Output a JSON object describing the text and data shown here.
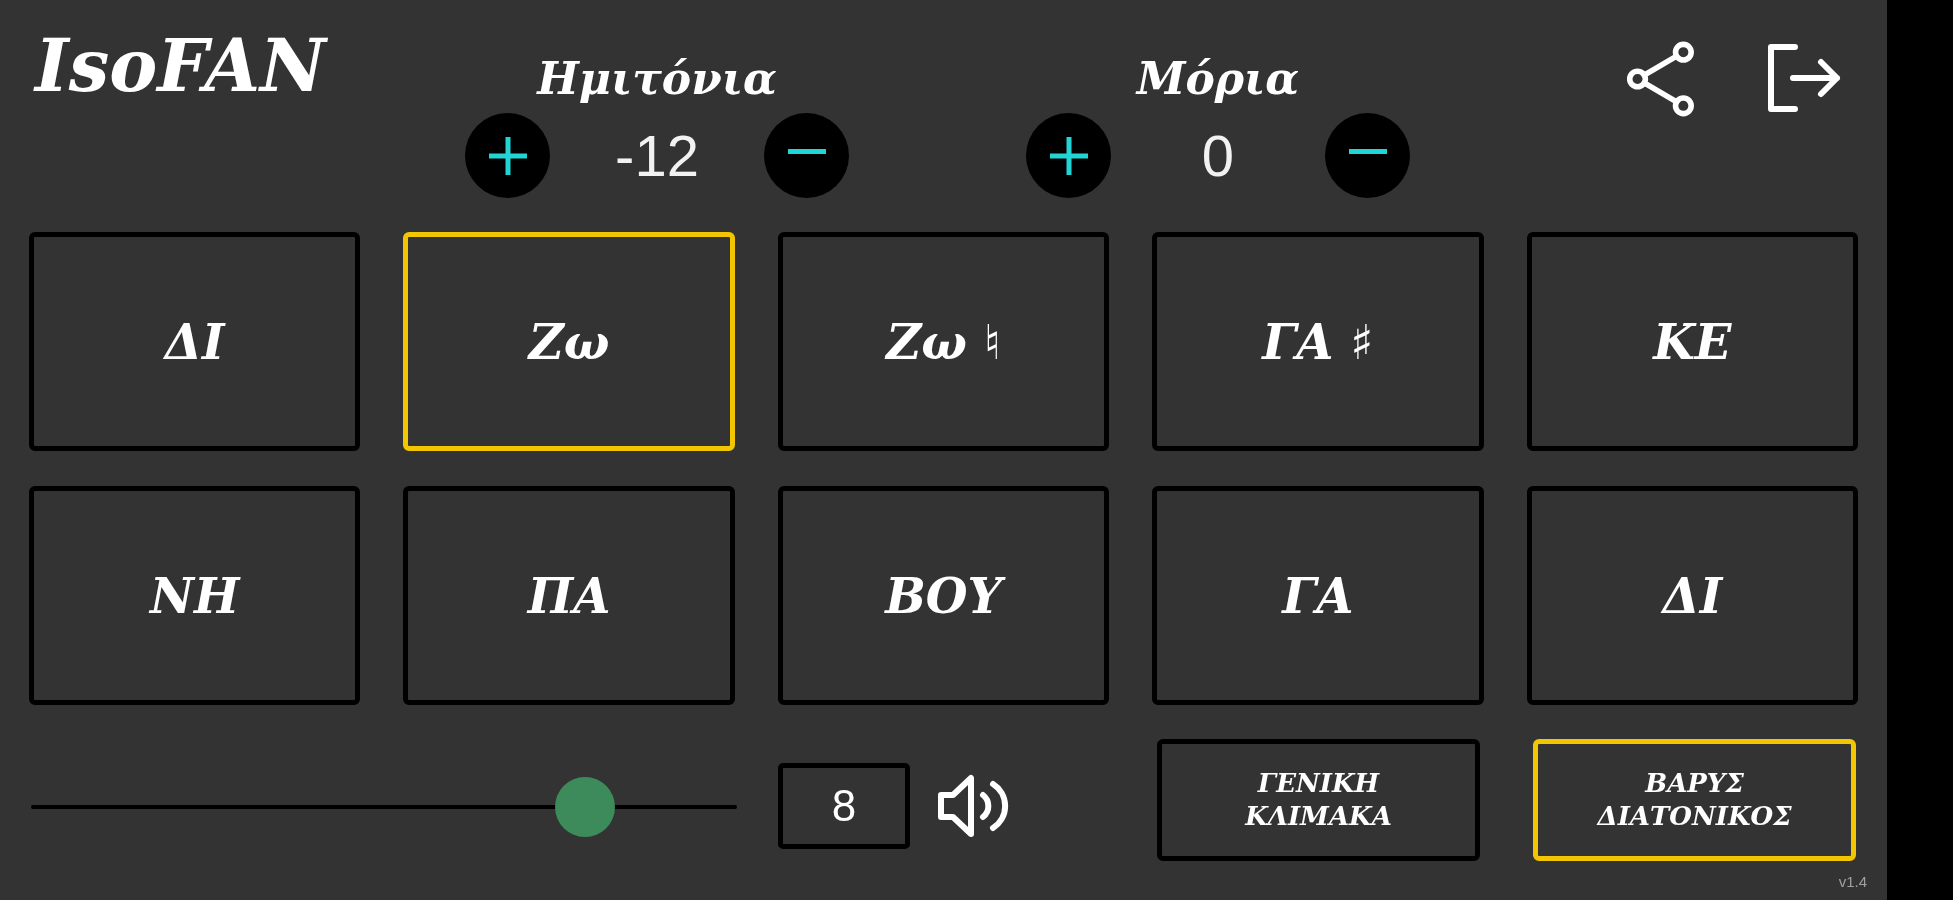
{
  "app": {
    "title": "IsoFAN",
    "version": "v1.4"
  },
  "counters": [
    {
      "label": "Ημιτόνια",
      "value": "-12"
    },
    {
      "label": "Μόρια",
      "value": "0"
    }
  ],
  "notes": [
    {
      "label": "ΔΙ",
      "selected": false
    },
    {
      "label": "Ζω",
      "selected": true
    },
    {
      "label": "Ζω ♮",
      "selected": false
    },
    {
      "label": "ΓΑ ♯",
      "selected": false
    },
    {
      "label": "ΚΕ",
      "selected": false
    },
    {
      "label": "ΝΗ",
      "selected": false
    },
    {
      "label": "ΠΑ",
      "selected": false
    },
    {
      "label": "ΒΟΥ",
      "selected": false
    },
    {
      "label": "ΓΑ",
      "selected": false
    },
    {
      "label": "ΔΙ",
      "selected": false
    }
  ],
  "volume": {
    "level": 0.785,
    "value": "8"
  },
  "scales": [
    {
      "label": "ΓΕΝΙΚΗ\nΚΛΙΜΑΚΑ",
      "selected": false
    },
    {
      "label": "ΒΑΡΥΣ\nΔΙΑΤΟΝΙΚΟΣ",
      "selected": true
    }
  ]
}
